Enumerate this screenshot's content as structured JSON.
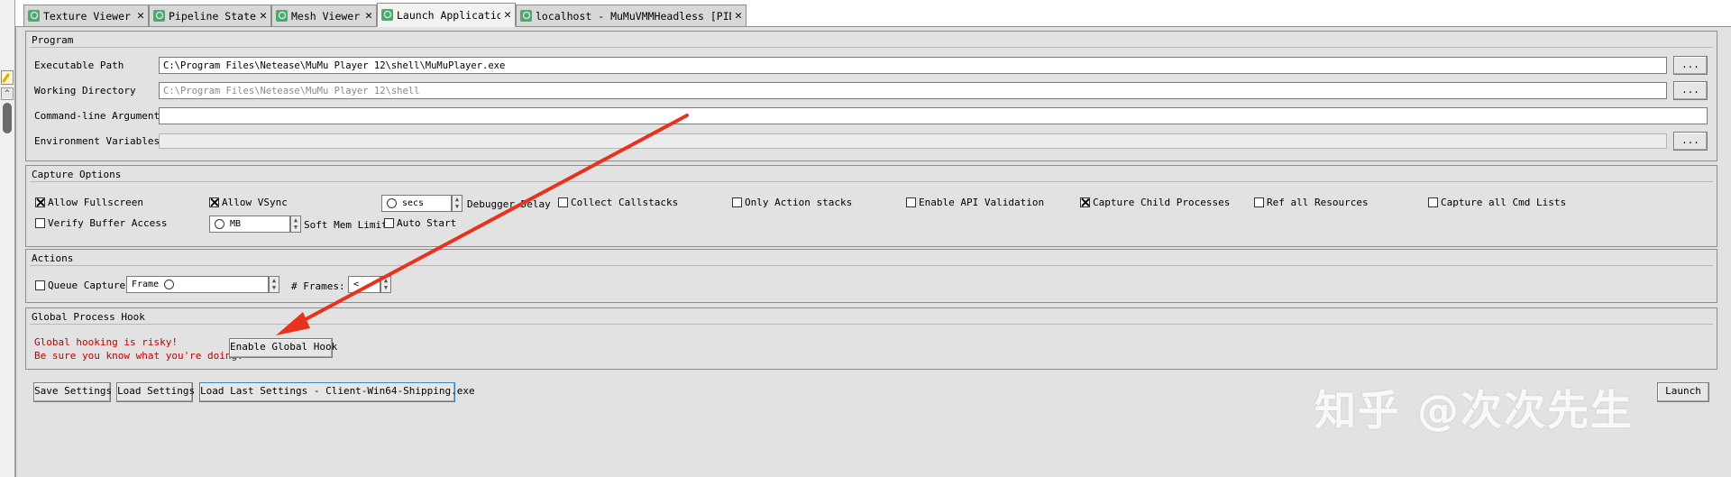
{
  "tabs": [
    {
      "label": "Texture Viewer",
      "close": "✕",
      "icon": "tab-app-icon"
    },
    {
      "label": "Pipeline State",
      "close": "✕",
      "icon": "tab-app-icon"
    },
    {
      "label": "Mesh Viewer",
      "close": "✕",
      "icon": "tab-app-icon"
    },
    {
      "label": "Launch Application",
      "close": "✕",
      "icon": "tab-app-icon",
      "active": true
    },
    {
      "label": "localhost - MuMuVMMHeadless [PID …",
      "close": "✕",
      "icon": "tab-app-icon"
    }
  ],
  "program": {
    "title": "Program",
    "executable_label": "Executable Path",
    "executable_value": "C:\\Program Files\\Netease\\MuMu Player 12\\shell\\MuMuPlayer.exe",
    "workdir_label": "Working Directory",
    "workdir_placeholder": "C:\\Program Files\\Netease\\MuMu Player 12\\shell",
    "cmdline_label": "Command-line Arguments",
    "cmdline_value": "",
    "env_label": "Environment Variables",
    "browse_label": "..."
  },
  "capture": {
    "title": "Capture Options",
    "allow_fullscreen": "Allow Fullscreen",
    "allow_vsync": "Allow VSync",
    "delay_value": "secs",
    "debugger_delay": "Debugger Delay",
    "collect_callstacks": "Collect Callstacks",
    "only_action_stacks": "Only Action stacks",
    "enable_api_validation": "Enable API Validation",
    "capture_child": "Capture Child Processes",
    "ref_all_resources": "Ref all Resources",
    "capture_all_cmd": "Capture all Cmd Lists",
    "verify_buffer": "Verify Buffer Access",
    "mem_value": "MB",
    "soft_mem_limit": "Soft Mem Limit",
    "auto_start": "Auto Start",
    "checked": {
      "allow_fullscreen": true,
      "allow_vsync": true,
      "capture_child": true
    }
  },
  "actions": {
    "title": "Actions",
    "queue_capture": "Queue Capture",
    "frame_value": "Frame",
    "frames_label": "# Frames:",
    "frames_value": "<"
  },
  "hook": {
    "title": "Global Process Hook",
    "warning_line1": "Global hooking is risky!",
    "warning_line2": "Be sure you know what you're doing.",
    "enable_button": "Enable Global Hook"
  },
  "footer": {
    "save_settings": "Save Settings",
    "load_settings": "Load Settings",
    "load_last": "Load Last Settings - Client-Win64-Shipping.exe",
    "launch": "Launch"
  },
  "watermark": "知乎 @次次先生",
  "colors": {
    "warning": "#c00000",
    "annotation_arrow": "#e8321e",
    "tab_icon": "#4faa72"
  }
}
